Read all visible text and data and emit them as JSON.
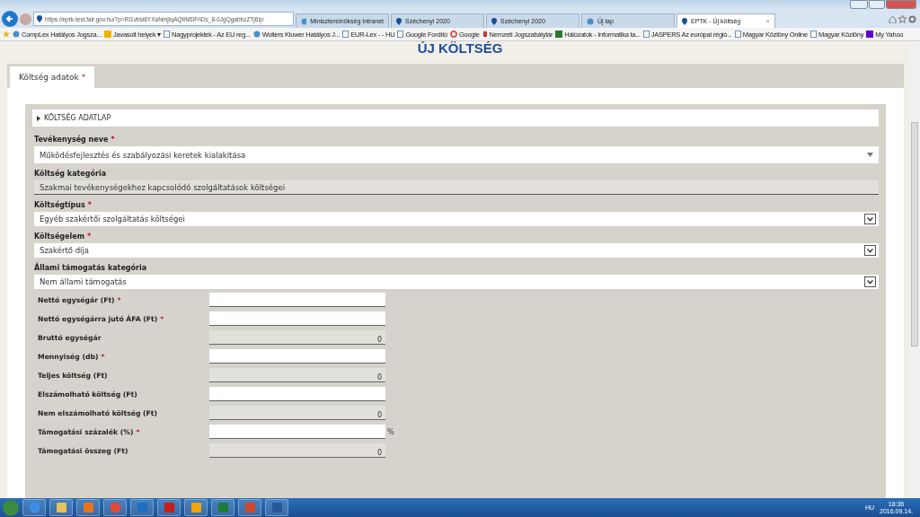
{
  "browser": {
    "address": "https://eptk-test.fair.gov.hu/?p=RI1vbsi8YXaNmjtqAQtIMDFhDs_8-0JgQgabbzZTj6Ip:",
    "tabs": [
      {
        "label": "Miniszterelnökség Intranet",
        "selected": false
      },
      {
        "label": "Széchenyi 2020",
        "selected": false
      },
      {
        "label": "Széchenyi 2020",
        "selected": false
      },
      {
        "label": "Új lap",
        "selected": false
      },
      {
        "label": "EPTK - Új költség",
        "selected": true,
        "close": "×"
      }
    ],
    "bookmarks": [
      "CompLex Hatályos Jogsza...",
      "Javasolt helyek ▾",
      "Nagyprojektek - Az EU reg...",
      "Wolters Kluwer Hatályos J...",
      "EUR-Lex - - HU",
      "Google Fordító",
      "Google",
      "Nemzeti Jogszabálytár",
      "Hálózatok - Informatika ta...",
      "JASPERS Az európai régió...",
      "Magyar Közlöny Online",
      "Magyar Közlöny",
      "My Yahoo"
    ]
  },
  "page": {
    "title": "ÚJ KÖLTSÉG",
    "tabs": [
      {
        "label": "Költség adatok",
        "mark": "*",
        "selected": true
      }
    ],
    "section": {
      "title": "KÖLTSÉG ADATLAP",
      "expanded": false
    },
    "selects": [
      {
        "label": "Tevékenység neve",
        "mark": "*",
        "value": "Működésfejlesztés és szabályozási keretek kialakítása",
        "kind": "combo"
      },
      {
        "label": "Költség kategória",
        "value": "Szakmai tevékenységekhez kapcsolódó szolgáltatások költségei",
        "kind": "readonly"
      },
      {
        "label": "Költségtípus",
        "mark": "*",
        "value": "Egyéb szakértői szolgáltatás költségei",
        "kind": "dropdown"
      },
      {
        "label": "Költségelem",
        "mark": "*",
        "value": "Szakértő díja",
        "kind": "dropdown"
      },
      {
        "label": "Állami támogatás kategória",
        "value": "Nem állami támogatás",
        "kind": "dropdown"
      }
    ],
    "amounts": [
      {
        "label": "Nettó egységár (Ft)",
        "mark": "*",
        "readonly": false
      },
      {
        "label": "Nettó egységárra jutó ÁFA (Ft)",
        "mark": "*",
        "readonly": false
      },
      {
        "label": "Bruttó egységár",
        "readonly": true,
        "value": "0"
      },
      {
        "label": "Mennyiség (db)",
        "mark": "*",
        "readonly": false
      },
      {
        "label": "Teljes költség (Ft)",
        "readonly": true,
        "value": "0"
      },
      {
        "label": "Elszámolható költség (Ft)",
        "readonly": false
      },
      {
        "label": "Nem elszámolható költség (Ft)",
        "readonly": true,
        "value": "0"
      },
      {
        "label": "Támogatási százalék (%)",
        "mark": "*",
        "readonly": false,
        "suffix": "%"
      },
      {
        "label": "Támogatási összeg (Ft)",
        "readonly": true,
        "value": "0"
      }
    ]
  },
  "taskbar": {
    "language": "HU",
    "time": "18:36",
    "date": "2016.09.14."
  }
}
